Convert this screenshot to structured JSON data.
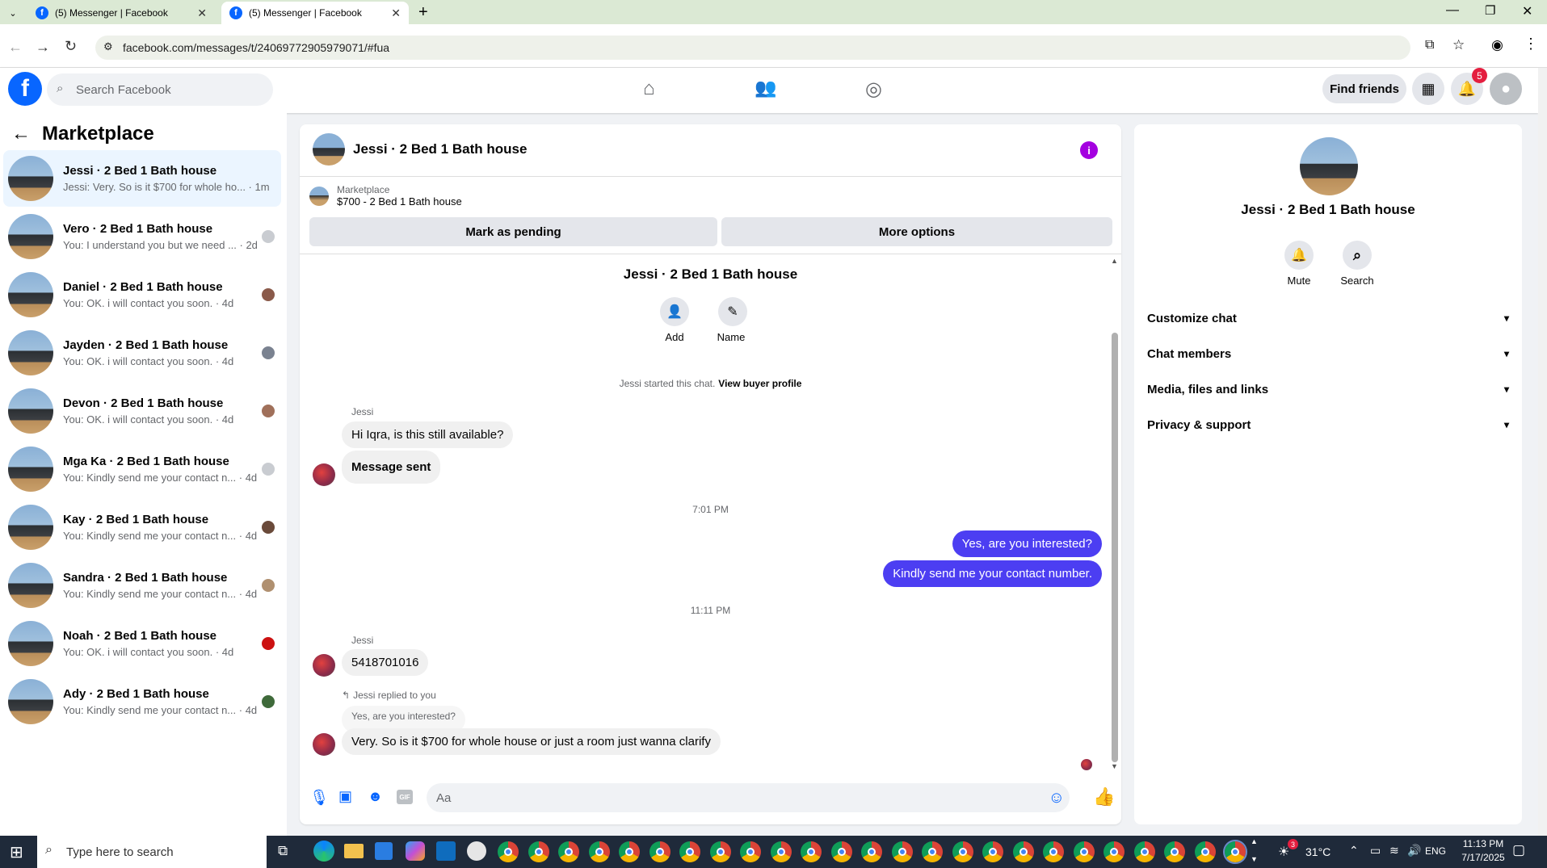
{
  "browser": {
    "tabs": [
      {
        "label": "(5) Messenger | Facebook",
        "active": false
      },
      {
        "label": "(5) Messenger | Facebook",
        "active": true
      }
    ],
    "url": "facebook.com/messages/t/24069772905979071/#fua"
  },
  "header": {
    "search_placeholder": "Search Facebook",
    "find_friends": "Find friends",
    "notif_count": "5"
  },
  "sidebar": {
    "title": "Marketplace",
    "items": [
      {
        "name": "Jessi · 2 Bed 1 Bath house",
        "preview": "Jessi: Very. So is it $700 for whole ho... · 1m",
        "avatar_color": "#ffffff"
      },
      {
        "name": "Vero · 2 Bed 1 Bath house",
        "preview": "You: I understand you but we need ... · 2d",
        "avatar_color": "#c9ccd1"
      },
      {
        "name": "Daniel · 2 Bed 1 Bath house",
        "preview": "You: OK. i will contact you soon. · 4d",
        "avatar_color": "#8a5a4a"
      },
      {
        "name": "Jayden · 2 Bed 1 Bath house",
        "preview": "You: OK. i will contact you soon. · 4d",
        "avatar_color": "#7a8290"
      },
      {
        "name": "Devon · 2 Bed 1 Bath house",
        "preview": "You: OK. i will contact you soon. · 4d",
        "avatar_color": "#a0705a"
      },
      {
        "name": "Mga Ka · 2 Bed 1 Bath house",
        "preview": "You: Kindly send me your contact n... · 4d",
        "avatar_color": "#c9ccd1"
      },
      {
        "name": "Kay · 2 Bed 1 Bath house",
        "preview": "You: Kindly send me your contact n... · 4d",
        "avatar_color": "#6a4a3a"
      },
      {
        "name": "Sandra · 2 Bed 1 Bath house",
        "preview": "You: Kindly send me your contact n... · 4d",
        "avatar_color": "#b09070"
      },
      {
        "name": "Noah · 2 Bed 1 Bath house",
        "preview": "You: OK. i will contact you soon. · 4d",
        "avatar_color": "#cc1111"
      },
      {
        "name": "Ady · 2 Bed 1 Bath house",
        "preview": "You: Kindly send me your contact n... · 4d",
        "avatar_color": "#3f6a3a"
      }
    ]
  },
  "chat": {
    "title": "Jessi · 2 Bed 1 Bath house",
    "listing_label": "Marketplace",
    "listing_title": "$700 - 2 Bed 1 Bath house",
    "mark_pending": "Mark as pending",
    "more_options": "More options",
    "profile_name": "Jessi · 2 Bed 1 Bath house",
    "add_label": "Add",
    "name_label": "Name",
    "started_text": "Jessi started this chat.",
    "view_profile": "View buyer profile",
    "sender": "Jessi",
    "msg1": "Hi Iqra, is this still available?",
    "msg2": "Message sent",
    "time1": "7:01 PM",
    "mine1": "Yes, are you interested?",
    "mine2": "Kindly send me your contact number.",
    "time2": "11:11 PM",
    "msg3": "5418701016",
    "replied": "Jessi replied to you",
    "quoted": "Yes, are you interested?",
    "msg4": "Very. So is it $700 for whole house or just a room just wanna clarify",
    "composer_placeholder": "Aa"
  },
  "details": {
    "name": "Jessi · 2 Bed 1 Bath house",
    "mute": "Mute",
    "search": "Search",
    "sections": [
      "Customize chat",
      "Chat members",
      "Media, files and links",
      "Privacy & support"
    ]
  },
  "taskbar": {
    "search_placeholder": "Type here to search",
    "weather": "31°C",
    "lang": "ENG",
    "time": "11:13 PM",
    "date": "7/17/2025",
    "weather_badge": "3"
  },
  "colors": {
    "fb_blue": "#0866ff",
    "my_bubble": "#4c3ef2",
    "info": "#a400e0"
  }
}
